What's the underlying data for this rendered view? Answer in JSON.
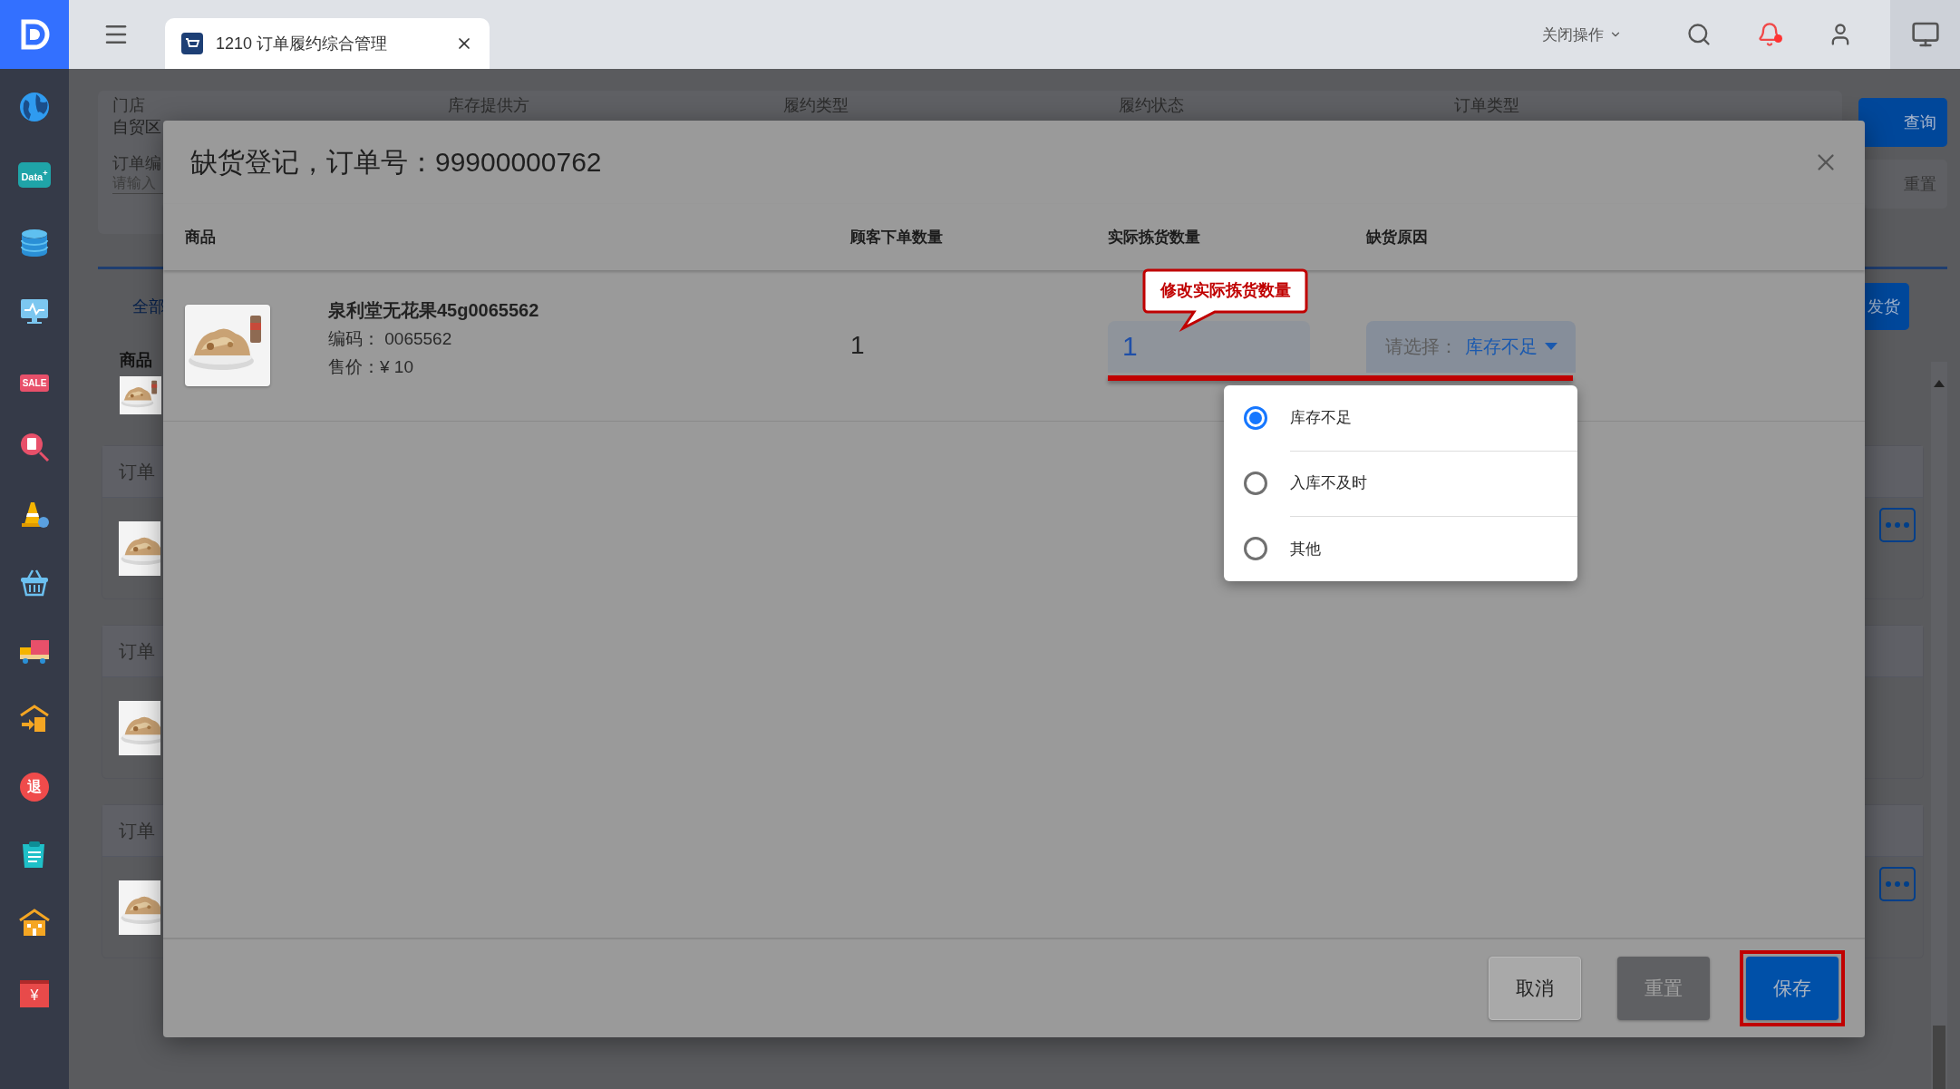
{
  "sidebar": {
    "items": [
      {
        "kind": "globe"
      },
      {
        "kind": "badge",
        "text": "Data$^{+}$"
      },
      {
        "kind": "database"
      },
      {
        "kind": "monitor"
      },
      {
        "kind": "sign",
        "text": "SALE"
      },
      {
        "kind": "search-doc"
      },
      {
        "kind": "cone"
      },
      {
        "kind": "basket"
      },
      {
        "kind": "truck"
      },
      {
        "kind": "warehouse"
      },
      {
        "kind": "circle",
        "text": "退"
      },
      {
        "kind": "clipboard"
      },
      {
        "kind": "house"
      },
      {
        "kind": "box",
        "text": "¥"
      }
    ]
  },
  "tabs": [
    {
      "label": "1210 订单履约综合管理",
      "selected": true
    }
  ],
  "topbar": {
    "close_menu": "关闭操作",
    "notification": true
  },
  "page": {
    "filters": [
      {
        "label": "门店",
        "value": "自贸区"
      },
      {
        "label": "库存提供方"
      },
      {
        "label": "履约类型"
      },
      {
        "label": "履约状态"
      },
      {
        "label": "订单类型"
      }
    ],
    "order_field": {
      "label": "订单编",
      "placeholder": "请输入"
    },
    "buttons": [
      "查询",
      "重置"
    ],
    "tab": "全部",
    "batch_button": "发货",
    "list_header": "商品",
    "cards": [
      {
        "title": "订单",
        "more": true
      },
      {
        "title": "订单",
        "more": false
      },
      {
        "title": "订单",
        "more": true
      }
    ]
  },
  "dialog": {
    "title": "缺货登记，订单号：99900000762",
    "columns": [
      "商品",
      "顾客下单数量",
      "实际拣货数量",
      "缺货原因"
    ],
    "rows": [
      {
        "name": "泉利堂无花果45g0065562",
        "code_label": "编码：",
        "code": "0065562",
        "price_label": "售价：",
        "price": "¥ 10",
        "ordered": "1",
        "picked": "1",
        "reason_prompt": "请选择：",
        "reason": "库存不足"
      }
    ],
    "callout": "修改实际拣货数量",
    "options": [
      {
        "label": "库存不足",
        "selected": true
      },
      {
        "label": "入库不及时",
        "selected": false
      },
      {
        "label": "其他",
        "selected": false
      }
    ],
    "buttons": [
      {
        "label": "取消",
        "kind": "default",
        "highlighted": false
      },
      {
        "label": "重置",
        "kind": "disabled",
        "highlighted": false
      },
      {
        "label": "保存",
        "kind": "primary",
        "highlighted": true
      }
    ]
  }
}
